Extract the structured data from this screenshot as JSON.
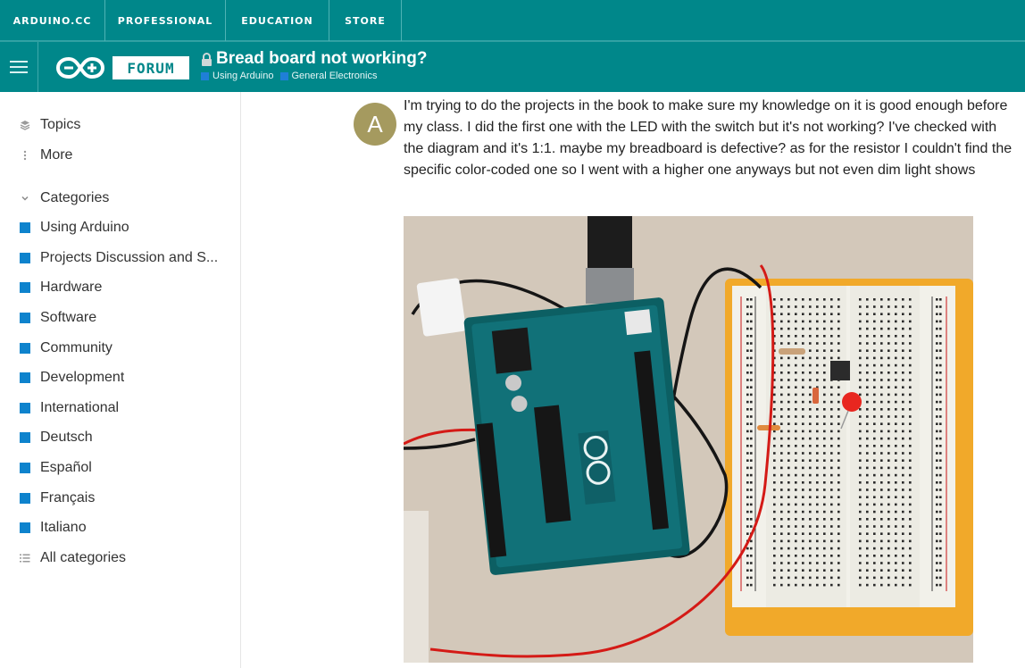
{
  "top_nav": {
    "items": [
      "ARDUINO.CC",
      "PROFESSIONAL",
      "EDUCATION",
      "STORE"
    ]
  },
  "header": {
    "forum_label": "FORUM",
    "topic_title": "Bread board not working?",
    "breadcrumbs": [
      "Using Arduino",
      "General Electronics"
    ]
  },
  "sidebar": {
    "topics_label": "Topics",
    "more_label": "More",
    "categories_label": "Categories",
    "categories": [
      "Using Arduino",
      "Projects Discussion and S...",
      "Hardware",
      "Software",
      "Community",
      "Development",
      "International",
      "Deutsch",
      "Español",
      "Français",
      "Italiano"
    ],
    "all_categories_label": "All categories"
  },
  "post": {
    "avatar_letter": "A",
    "avatar_color": "#a59a5f",
    "text": "I'm trying to do the projects in the book to make sure my knowledge on it is good enough before my class. I did the first one with the LED with the switch but it's not working? I've checked with the diagram and it's 1:1. maybe my breadboard is defective? as for the resistor I couldn't find the specific color-coded one so I went with a higher one anyways but not even dim light shows"
  },
  "colors": {
    "brand_teal": "#00878a",
    "category_blue": "#0e83cd"
  }
}
